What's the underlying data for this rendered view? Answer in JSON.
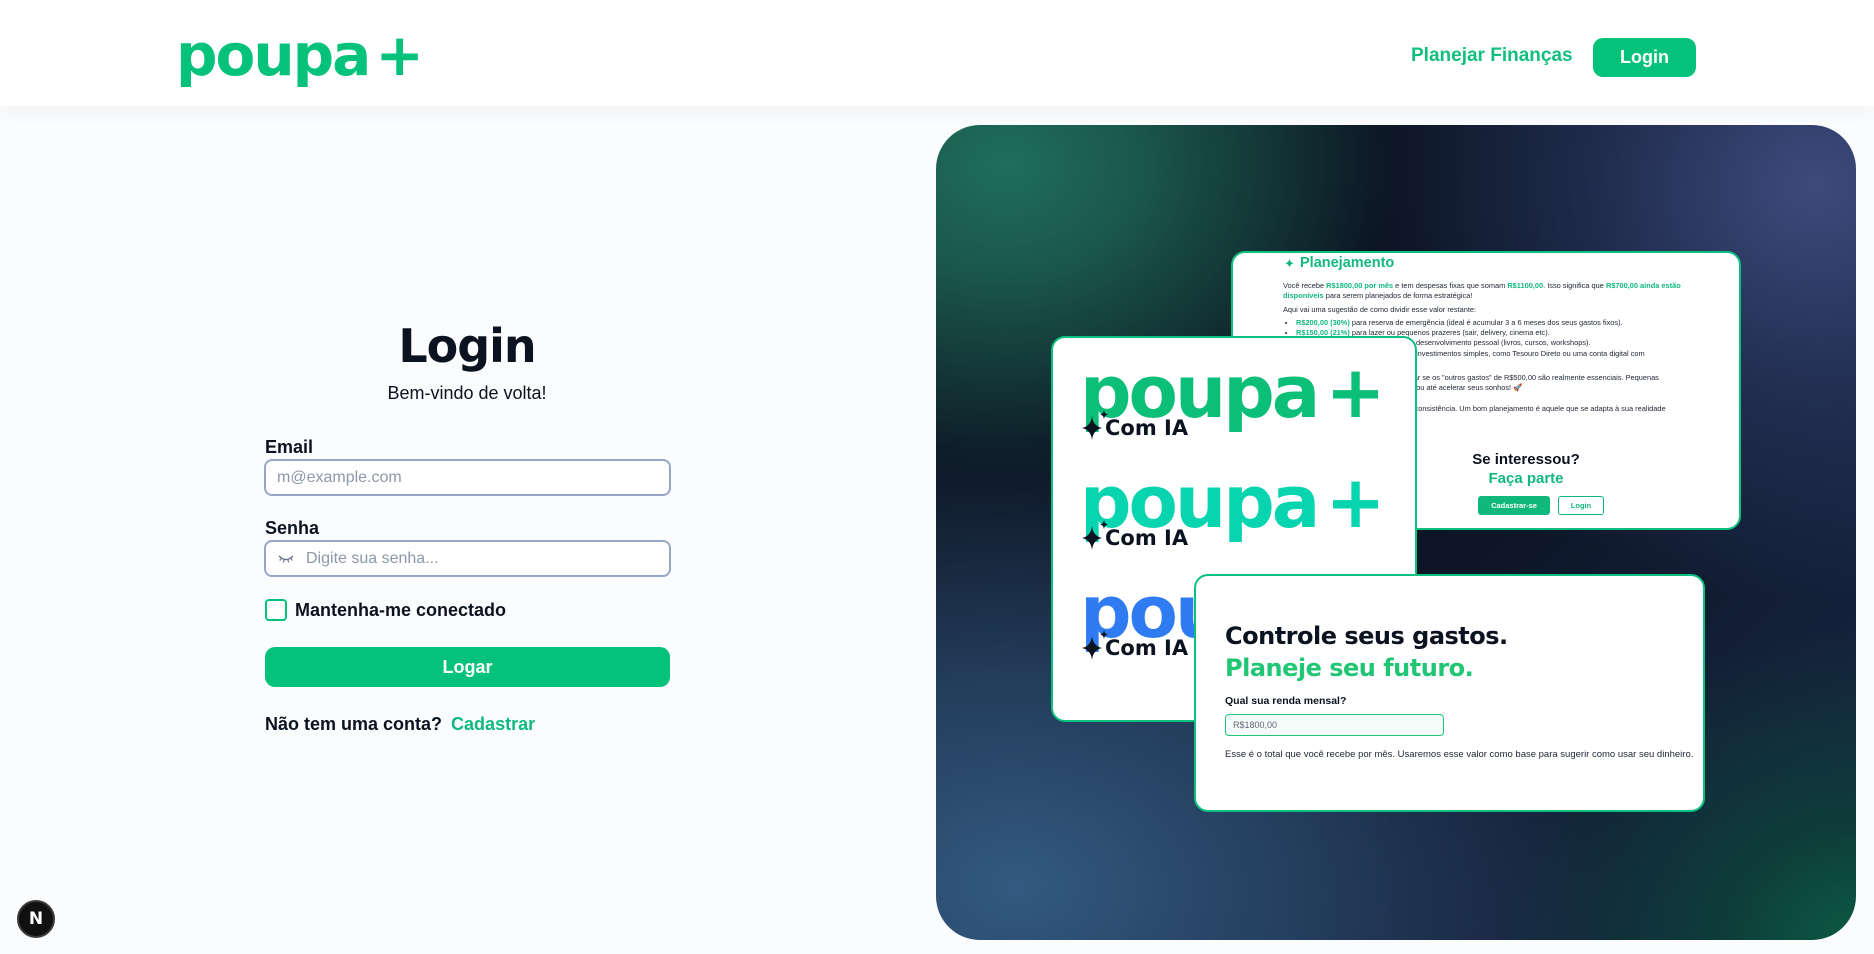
{
  "header": {
    "logo_text": "poupa",
    "logo_plus": "+",
    "nav_link": "Planejar Finanças",
    "login_button": "Login"
  },
  "form": {
    "title": "Login",
    "subtitle": "Bem-vindo de volta!",
    "email_label": "Email",
    "email_placeholder": "m@example.com",
    "password_label": "Senha",
    "password_placeholder": "Digite sua senha...",
    "remember_label": "Mantenha-me conectado",
    "remember_checked": false,
    "submit_label": "Logar",
    "signup_prompt": "Não tem uma conta?",
    "signup_link": "Cadastrar"
  },
  "badge": {
    "letter": "N"
  },
  "panel": {
    "card_plan": {
      "title": "Planejamento",
      "p1_a": "Você recebe ",
      "p1_b": "R$1800,00 por mês",
      "p1_c": " e tem despesas fixas que somam ",
      "p1_d": "R$1100,00",
      "p1_e": ". Isso significa que ",
      "p1_f": "R$700,00 ainda estão disponíveis",
      "p1_g": " para serem planejados de forma estratégica!",
      "p2": "Aqui vai uma sugestão de como dividir esse valor restante:",
      "b1_a": "R$200,00 (30%)",
      "b1_b": " para reserva de emergência (ideal é acumular 3 a 6 meses dos seus gastos fixos).",
      "b2_a": "R$150,00 (21%)",
      "b2_b": " para lazer ou pequenos prazeres (sair, delivery, cinema etc).",
      "b3": "desenvolvimento pessoal (livros, cursos, workshops).",
      "b4": "investimentos simples, como Tesouro Direto ou uma conta digital com",
      "p3": "car se os \"outros gastos\" de R$500,00 são realmente essenciais. Pequenas",
      "p3b": "a ou até acelerar seus sonhos! 🚀",
      "p4": "r consistência. Um bom planejamento é aquele que se adapta à sua realidade",
      "question": "Se interessou?",
      "cta": "Faça parte",
      "btn_signup": "Cadastrar-se",
      "btn_login": "Login"
    },
    "card_logos": {
      "logo_text": "poupa",
      "logo_plus": "+",
      "tagline": "Com IA",
      "colors": [
        "#0cbf79",
        "#08d4b0",
        "#2f7cf2"
      ]
    },
    "card_controle": {
      "headline": "Controle seus gastos.",
      "headline2": "Planeje seu futuro.",
      "question": "Qual sua renda mensal?",
      "input_value": "R$1800,00",
      "help": "Esse é o total que você recebe por mês. Usaremos esse valor como base para sugerir como usar seu dinheiro."
    }
  },
  "colors": {
    "brand": "#05c27a",
    "text": "#0b1220",
    "input_border": "#97a6c8"
  }
}
